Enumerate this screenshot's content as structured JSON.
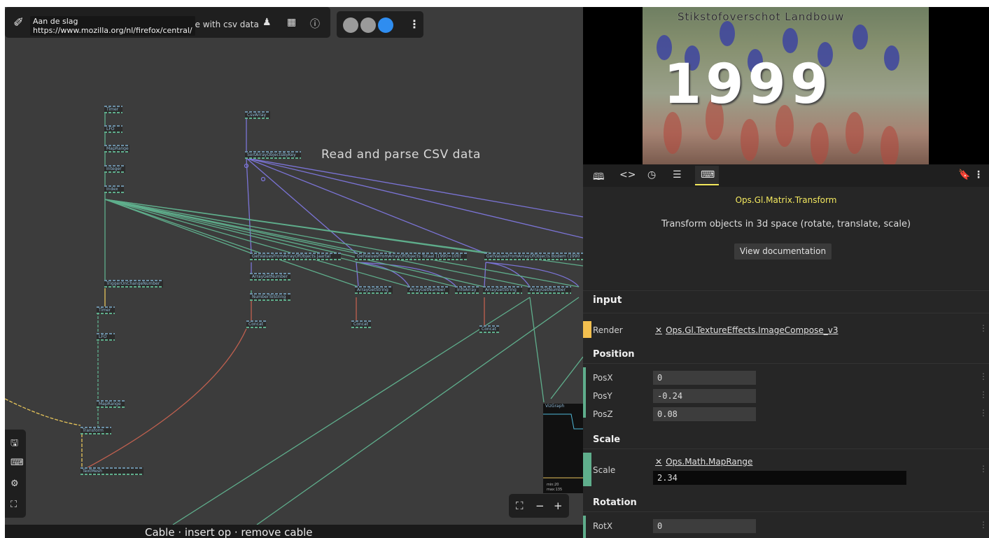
{
  "topbar": {
    "tooltip_title": "Aan de slag",
    "tooltip_url": "https://www.mozilla.org/nl/firefox/central/",
    "patch_name": "nple with csv data"
  },
  "canvas": {
    "title": "Read and parse CSV data",
    "ops": {
      "timer1": "Timer",
      "lfo1": "LFO",
      "maprange1": "MapRange",
      "integer": "Integer",
      "index": "Index",
      "csvarray": "CsvArray",
      "sortarray": "SortArrayObjectsByKey",
      "getvalues1": "GetValuesFromArrayOfObjects  Jaartal",
      "getvalues2": "GetValuesFromArrayOfObjects  Totaal (1990=100)",
      "getvalues3": "GetValuesFromArrayOfObjects  Bodem (1990",
      "arraygetnumber1": "ArrayGetNumber",
      "numbertostring": "NumberToString",
      "concat1": "Concat",
      "arraygetstring1": "ArrayGetString",
      "arraygetnumber2": "ArrayGetNumber",
      "infoarray": "InfoArray",
      "arraygetstring2": "ArrayGetString",
      "arraygetnumber3": "ArrayGetNumber",
      "concat2": "Concat",
      "concat3": "Concat",
      "trigger": "TriggerOnChangeNumber",
      "timer2": "Timer",
      "lfo2": "LFO",
      "maprange2": "MapRange",
      "transform": "Transform",
      "textmesh": "TextMesh"
    },
    "vizgraph": {
      "label": "VizGraph",
      "min": "min:20",
      "max": "max:135"
    }
  },
  "bottombar": {
    "text": "Cable  ·  insert op  ·  remove cable",
    "url": "https://www.mozilla.org/nl/firefox/central/"
  },
  "preview": {
    "title": "Stikstofoverschot Landbouw",
    "year": "1999"
  },
  "panel": {
    "op_name": "Ops.Gl.Matrix.Transform",
    "description": "Transform objects in 3d space (rotate, translate, scale)",
    "view_doc": "View documentation",
    "sections": {
      "input": "input",
      "position": "Position",
      "scale": "Scale",
      "rotation": "Rotation"
    },
    "params": {
      "render_label": "Render",
      "render_link": "Ops.Gl.TextureEffects.ImageCompose_v3",
      "posx_label": "PosX",
      "posx": "0",
      "posy_label": "PosY",
      "posy": "-0.24",
      "posz_label": "PosZ",
      "posz": "0.08",
      "scale_label": "Scale",
      "scale_link": "Ops.Math.MapRange",
      "scale": "2.34",
      "rotx_label": "RotX",
      "rotx": "0"
    }
  },
  "colors": {
    "accent": "#f3e85f",
    "port_green": "#5fae8c",
    "cable_purple": "#7b74d6",
    "cable_red": "#c0604f",
    "cable_yellow": "#e6c45a"
  },
  "icons": [
    "pin-icon",
    "user-icon",
    "book-icon",
    "help-icon",
    "more-icon",
    "save-icon",
    "keyboard-icon",
    "settings-icon",
    "fit-icon",
    "minus-icon",
    "plus-icon",
    "docs-tab-icon",
    "code-tab-icon",
    "history-tab-icon",
    "list-tab-icon",
    "keyboard-tab-icon",
    "bookmark-icon"
  ]
}
